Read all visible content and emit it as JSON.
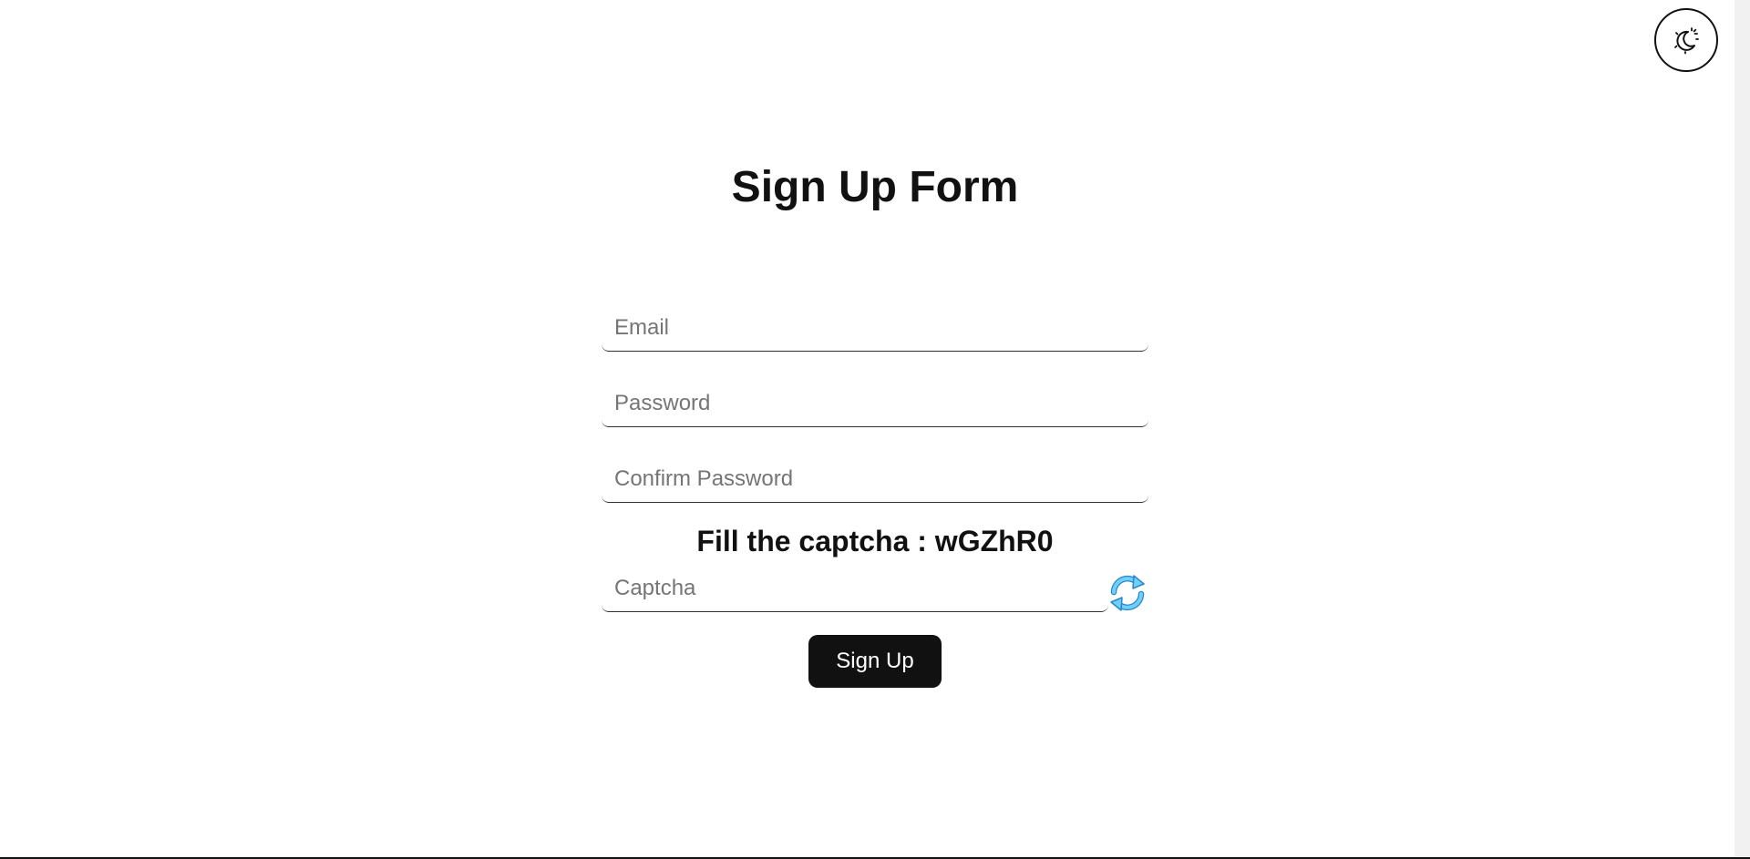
{
  "theme_toggle": {
    "icon": "moon-sun-icon"
  },
  "form": {
    "title": "Sign Up Form",
    "email_placeholder": "Email",
    "password_placeholder": "Password",
    "confirm_password_placeholder": "Confirm Password",
    "captcha_prompt": "Fill the captcha : wGZhR0",
    "captcha_placeholder": "Captcha",
    "refresh_icon": "refresh-icon",
    "submit_label": "Sign Up"
  },
  "colors": {
    "primary": "#111111",
    "background": "#ffffff",
    "refresh_icon": "#5bc8f5"
  }
}
